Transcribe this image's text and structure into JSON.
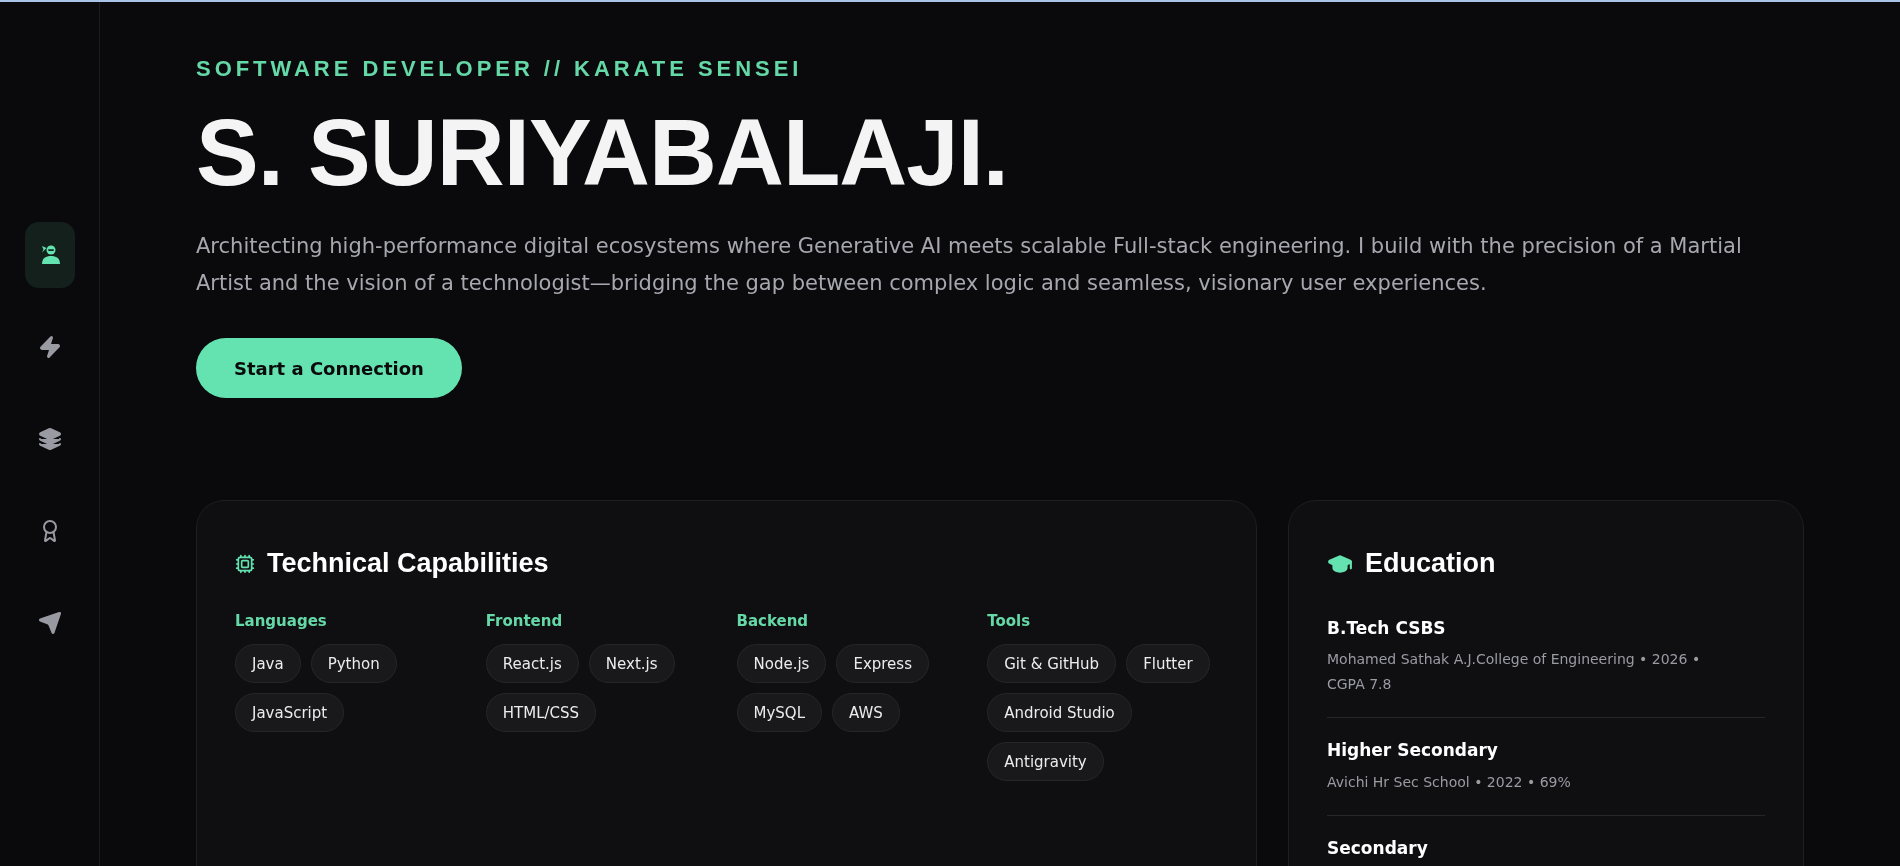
{
  "sidebar": {
    "items": [
      {
        "selected": true
      },
      {
        "selected": false
      },
      {
        "selected": false
      },
      {
        "selected": false
      },
      {
        "selected": false
      }
    ]
  },
  "hero": {
    "tagline": "SOFTWARE DEVELOPER // KARATE SENSEI",
    "name": "S. SURIYABALAJI.",
    "description": "Architecting high-performance digital ecosystems where Generative AI meets scalable Full-stack engineering. I build with the precision of a Martial Artist and the vision of a technologist—bridging the gap between complex logic and seamless, visionary user experiences.",
    "button": "Start a Connection"
  },
  "skills": {
    "title": "Technical Capabilities",
    "groups": [
      {
        "title": "Languages",
        "items": [
          "Java",
          "Python",
          "JavaScript"
        ]
      },
      {
        "title": "Frontend",
        "items": [
          "React.js",
          "Next.js",
          "HTML/CSS"
        ]
      },
      {
        "title": "Backend",
        "items": [
          "Node.js",
          "Express",
          "MySQL",
          "AWS"
        ]
      },
      {
        "title": "Tools",
        "items": [
          "Git & GitHub",
          "Flutter",
          "Android Studio",
          "Antigravity"
        ]
      }
    ]
  },
  "education": {
    "title": "Education",
    "entries": [
      {
        "degree": "B.Tech CSBS",
        "detail": "Mohamed Sathak A.J.College of Engineering • 2026 • CGPA 7.8"
      },
      {
        "degree": "Higher Secondary",
        "detail": "Avichi Hr Sec School • 2022 • 69%"
      },
      {
        "degree": "Secondary"
      }
    ]
  }
}
